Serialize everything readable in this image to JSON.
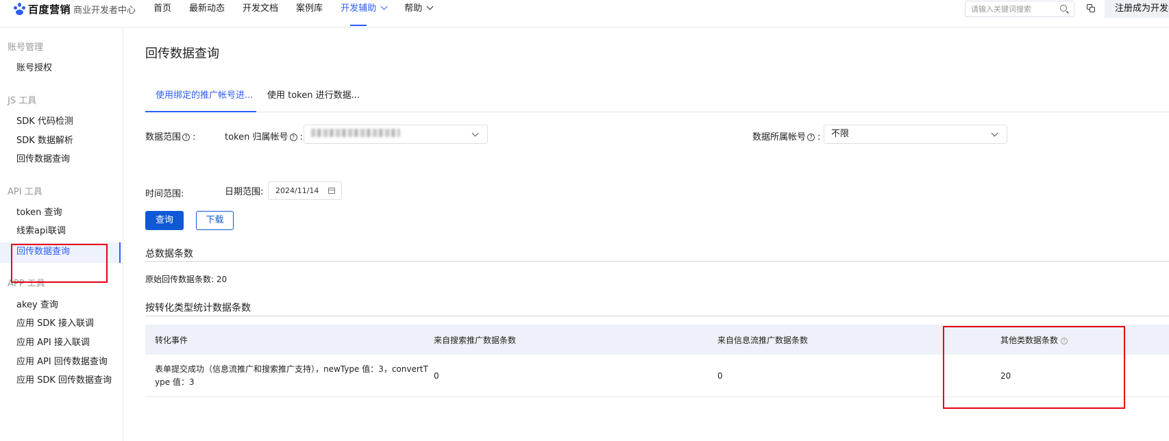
{
  "header": {
    "brand": "百度营销",
    "subtitle": "商业开发者中心",
    "nav": [
      {
        "label": "首页"
      },
      {
        "label": "最新动态"
      },
      {
        "label": "开发文档"
      },
      {
        "label": "案例库"
      },
      {
        "label": "开发辅助"
      },
      {
        "label": "帮助"
      }
    ],
    "active_nav": "开发辅助",
    "search_placeholder": "请输入关键词搜索",
    "register_label": "注册成为开发者",
    "accent_color": "#2d5cf6"
  },
  "sidebar": {
    "groups": [
      {
        "title": "账号管理",
        "items": [
          "账号授权"
        ]
      },
      {
        "title": "JS 工具",
        "items": [
          "SDK 代码检测",
          "SDK 数据解析",
          "回传数据查询"
        ]
      },
      {
        "title": "API 工具",
        "items": [
          "token 查询",
          "线索api联调",
          "回传数据查询"
        ]
      },
      {
        "title": "APP 工具",
        "items": [
          "akey 查询",
          "应用 SDK 接入联调",
          "应用 API 接入联调",
          "应用 API 回传数据查询",
          "应用 SDK 回传数据查询"
        ]
      }
    ],
    "active_item": "回传数据查询"
  },
  "main": {
    "title": "回传数据查询",
    "tabs": [
      {
        "label": "使用绑定的推广帐号进..."
      },
      {
        "label": "使用 token 进行数据..."
      }
    ],
    "form": {
      "data_range_label": "数据范围",
      "token_owner_label": "token 归属帐号",
      "token_owner_value": "",
      "data_account_label": "数据所属帐号",
      "data_account_value": "不限",
      "time_range_label": "时间范围:",
      "date_range_label": "日期范围:",
      "date_value": "2024/11/14",
      "query_button": "查询",
      "download_button": "下载"
    },
    "total": {
      "section_title": "总数据条数",
      "label": "原始回传数据条数:",
      "value": "20"
    },
    "stats": {
      "section_title": "按转化类型统计数据条数",
      "columns": [
        "转化事件",
        "来自搜索推广数据条数",
        "来自信息流推广数据条数",
        "其他类数据条数"
      ],
      "rows": [
        [
          "表单提交成功（信息流推广和搜索推广支持），newType 值：3，convertType 值：3",
          "0",
          "0",
          "20"
        ]
      ]
    }
  }
}
